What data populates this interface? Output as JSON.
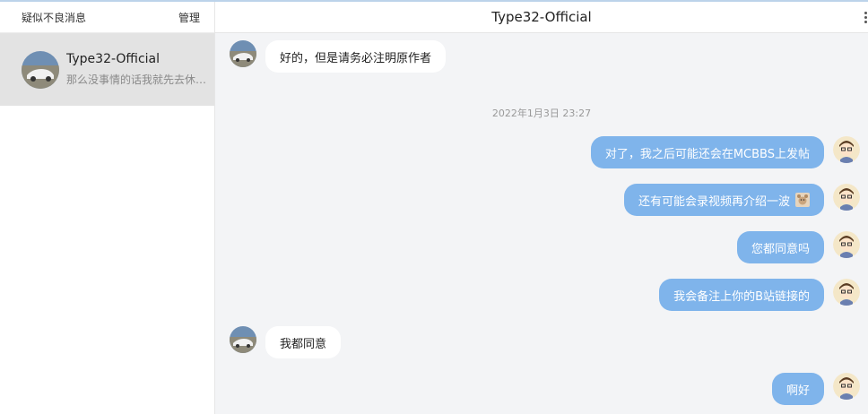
{
  "sidebar": {
    "title": "疑似不良消息",
    "manage_label": "管理",
    "conversation": {
      "name": "Type32-Official",
      "preview": "那么没事情的话我就先去休…"
    }
  },
  "chat": {
    "title": "Type32-Official",
    "timestamp": "2022年1月3日 23:27",
    "messages": [
      {
        "side": "left",
        "text": "好的，但是请务必注明原作者"
      },
      {
        "side": "right",
        "text": "对了，我之后可能还会在MCBBS上发帖"
      },
      {
        "side": "right",
        "text": "还有可能会录视频再介绍一波"
      },
      {
        "side": "right",
        "text": "您都同意吗"
      },
      {
        "side": "right",
        "text": "我会备注上你的B站链接的"
      },
      {
        "side": "left",
        "text": "我都同意"
      },
      {
        "side": "right",
        "text": "啊好"
      }
    ]
  },
  "colors": {
    "accent_bubble": "#7fb4eb",
    "selected_conversation": "#e3e3e3",
    "chat_background": "#f3f4f6"
  },
  "icons": [
    "car-avatar-icon",
    "cartoon-avatar-icon",
    "bear-emoji-icon",
    "more-vertical-icon"
  ]
}
